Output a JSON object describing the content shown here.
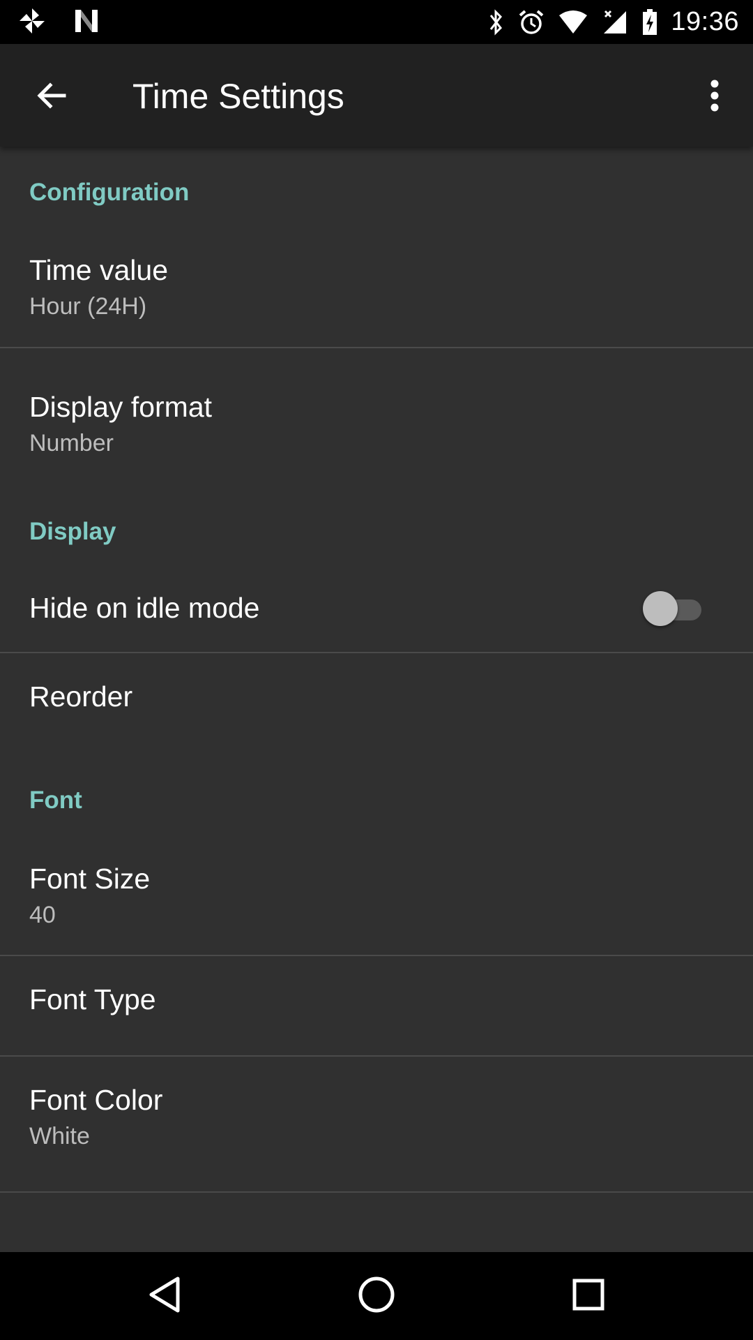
{
  "status_bar": {
    "time": "19:36",
    "left_icons": [
      "pinwheel-icon",
      "n-icon"
    ],
    "right_icons": [
      "bluetooth-icon",
      "alarm-icon",
      "wifi-icon",
      "signal-icon",
      "battery-charging-icon"
    ]
  },
  "app_bar": {
    "title": "Time Settings",
    "back_icon": "arrow-back-icon",
    "menu_icon": "more-vert-icon"
  },
  "sections": {
    "configuration": {
      "header": "Configuration",
      "time_value": {
        "title": "Time value",
        "summary": "Hour (24H)"
      },
      "display_format": {
        "title": "Display format",
        "summary": "Number"
      }
    },
    "display": {
      "header": "Display",
      "hide_idle": {
        "title": "Hide on idle mode",
        "enabled": false
      },
      "reorder": {
        "title": "Reorder"
      }
    },
    "font": {
      "header": "Font",
      "font_size": {
        "title": "Font Size",
        "summary": "40"
      },
      "font_type": {
        "title": "Font Type"
      },
      "font_color": {
        "title": "Font Color",
        "summary": "White"
      }
    }
  },
  "colors": {
    "accent": "#80cbc4",
    "background": "#303030",
    "app_bar": "#212121"
  },
  "nav_bar": {
    "icons": [
      "nav-back-icon",
      "nav-home-icon",
      "nav-recents-icon"
    ]
  }
}
